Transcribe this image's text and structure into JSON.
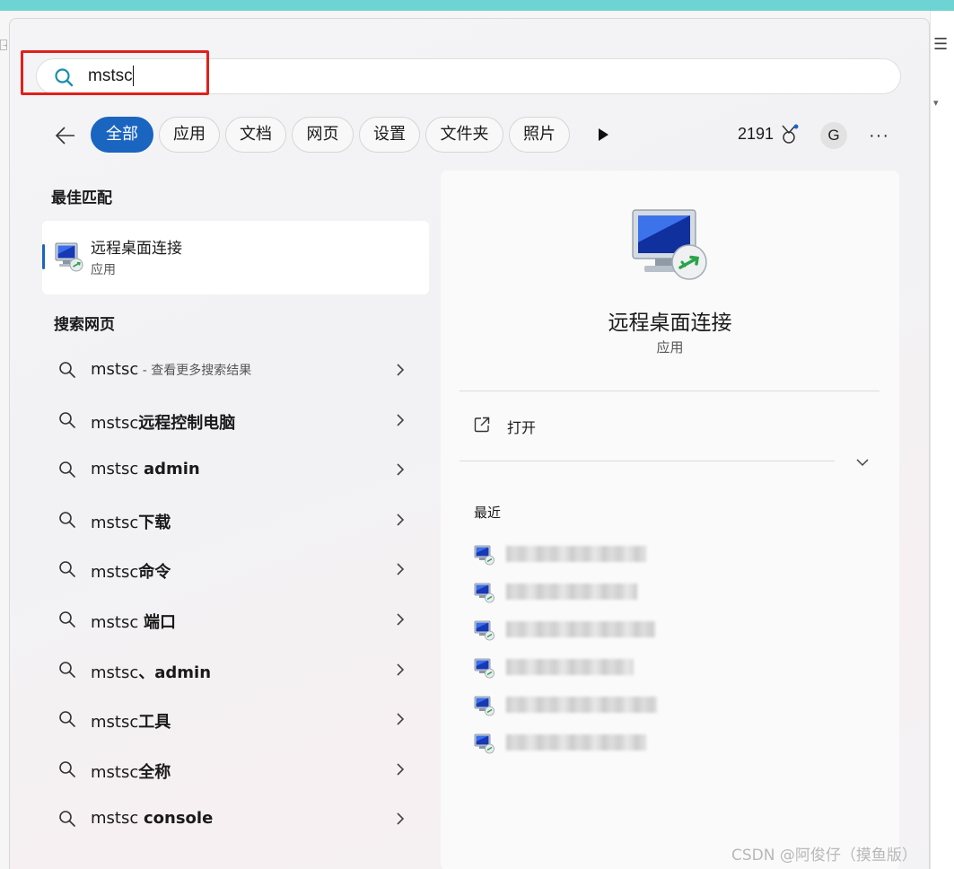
{
  "search": {
    "value": "mstsc"
  },
  "filters": {
    "tabs": [
      {
        "label": "全部",
        "active": true
      },
      {
        "label": "应用"
      },
      {
        "label": "文档"
      },
      {
        "label": "网页"
      },
      {
        "label": "设置"
      },
      {
        "label": "文件夹"
      },
      {
        "label": "照片"
      }
    ],
    "points": "2191",
    "avatar_initial": "G"
  },
  "best_match": {
    "section_title": "最佳匹配",
    "name": "远程桌面连接",
    "type": "应用"
  },
  "web_search": {
    "section_title": "搜索网页",
    "items": [
      {
        "prefix": "mstsc",
        "bold": "",
        "sub": " - 查看更多搜索结果"
      },
      {
        "prefix": "mstsc",
        "bold": "远程控制电脑",
        "sub": ""
      },
      {
        "prefix": "mstsc ",
        "bold": "admin",
        "sub": ""
      },
      {
        "prefix": "mstsc",
        "bold": "下载",
        "sub": ""
      },
      {
        "prefix": "mstsc",
        "bold": "命令",
        "sub": ""
      },
      {
        "prefix": "mstsc ",
        "bold": "端口",
        "sub": ""
      },
      {
        "prefix": "mstsc",
        "bold": "、admin",
        "sub": ""
      },
      {
        "prefix": "mstsc",
        "bold": "工具",
        "sub": ""
      },
      {
        "prefix": "mstsc",
        "bold": "全称",
        "sub": ""
      },
      {
        "prefix": "mstsc ",
        "bold": "console",
        "sub": ""
      }
    ]
  },
  "detail": {
    "name": "远程桌面连接",
    "type": "应用",
    "open_label": "打开",
    "recent_title": "最近",
    "recent_count": 6
  },
  "colors": {
    "accent": "#1a65c0",
    "highlight_border": "#e0201c",
    "top_bar": "#6dd3d3"
  },
  "watermark": "CSDN @阿俊仔（摸鱼版）"
}
